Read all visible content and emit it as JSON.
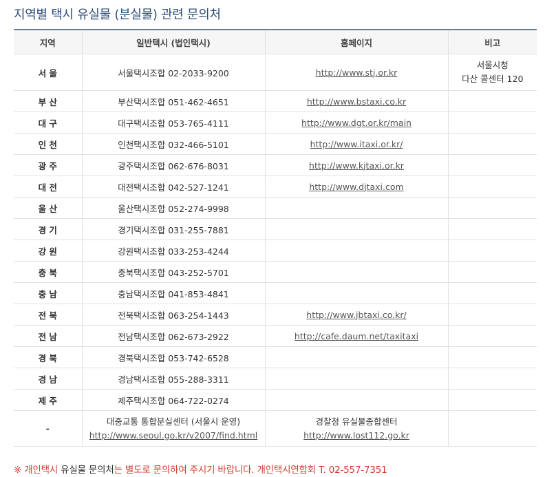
{
  "title": "지역별 택시 유실물 (분실물) 관련 문의처",
  "table": {
    "headers": [
      "지역",
      "일반택시 (법인택시)",
      "홈페이지",
      "비고"
    ],
    "rows": [
      {
        "region": "서 울",
        "contact": "서울택시조합 02-2033-9200",
        "homepage": "http://www.stj.or.kr",
        "note": [
          "서울시청",
          "다산 콜센터 120"
        ]
      },
      {
        "region": "부 산",
        "contact": "부산택시조합 051-462-4651",
        "homepage": "http://www.bstaxi.co.kr",
        "note": []
      },
      {
        "region": "대 구",
        "contact": "대구택시조합 053-765-4111",
        "homepage": "http://www.dgt.or.kr/main",
        "note": []
      },
      {
        "region": "인 천",
        "contact": "인천택시조합 032-466-5101",
        "homepage": "http://www.itaxi.or.kr/",
        "note": []
      },
      {
        "region": "광 주",
        "contact": "광주택시조합 062-676-8031",
        "homepage": "http://www.kjtaxi.or.kr",
        "note": []
      },
      {
        "region": "대 전",
        "contact": "대전택시조합 042-527-1241",
        "homepage": "http://www.djtaxi.com",
        "note": []
      },
      {
        "region": "울 산",
        "contact": "울산택시조합 052-274-9998",
        "homepage": "",
        "note": []
      },
      {
        "region": "경 기",
        "contact": "경기택시조합 031-255-7881",
        "homepage": "",
        "note": []
      },
      {
        "region": "강 원",
        "contact": "강원택시조합 033-253-4244",
        "homepage": "",
        "note": []
      },
      {
        "region": "충 북",
        "contact": "충북택시조합 043-252-5701",
        "homepage": "",
        "note": []
      },
      {
        "region": "충 남",
        "contact": "충남택시조합 041-853-4841",
        "homepage": "",
        "note": []
      },
      {
        "region": "전 북",
        "contact": "전북택시조합 063-254-1443",
        "homepage": "http://www.jbtaxi.co.kr/",
        "note": []
      },
      {
        "region": "전 남",
        "contact": "전남택시조합 062-673-2922",
        "homepage": "http://cafe.daum.net/taxitaxi",
        "note": []
      },
      {
        "region": "경 북",
        "contact": "경북택시조합 053-742-6528",
        "homepage": "",
        "note": []
      },
      {
        "region": "경 남",
        "contact": "경남택시조합 055-288-3311",
        "homepage": "",
        "note": []
      },
      {
        "region": "제 주",
        "contact": "제주택시조합 064-722-0274",
        "homepage": "",
        "note": []
      }
    ],
    "last_row": {
      "region": "-",
      "contact_name": "대중교통 통합분실센터 (서울시 운영)",
      "contact_link": "http://www.seoul.go.kr/v2007/find.html",
      "homepage_name": "경찰청 유실물종합센터",
      "homepage_link": "http://www.lost112.go.kr"
    }
  },
  "notice": {
    "mark": "※ 개인택시",
    "part1": " 유실물 문의처",
    "part2": "는 별도로 문의하여 주시기 바랍니다. 개인택시연합회 T. 02-557-7351"
  },
  "colors": {
    "title": "#2f4f77",
    "notice_red": "#d23a2f",
    "header_bg": "#f6f6f6",
    "border": "#e1e1e1"
  }
}
